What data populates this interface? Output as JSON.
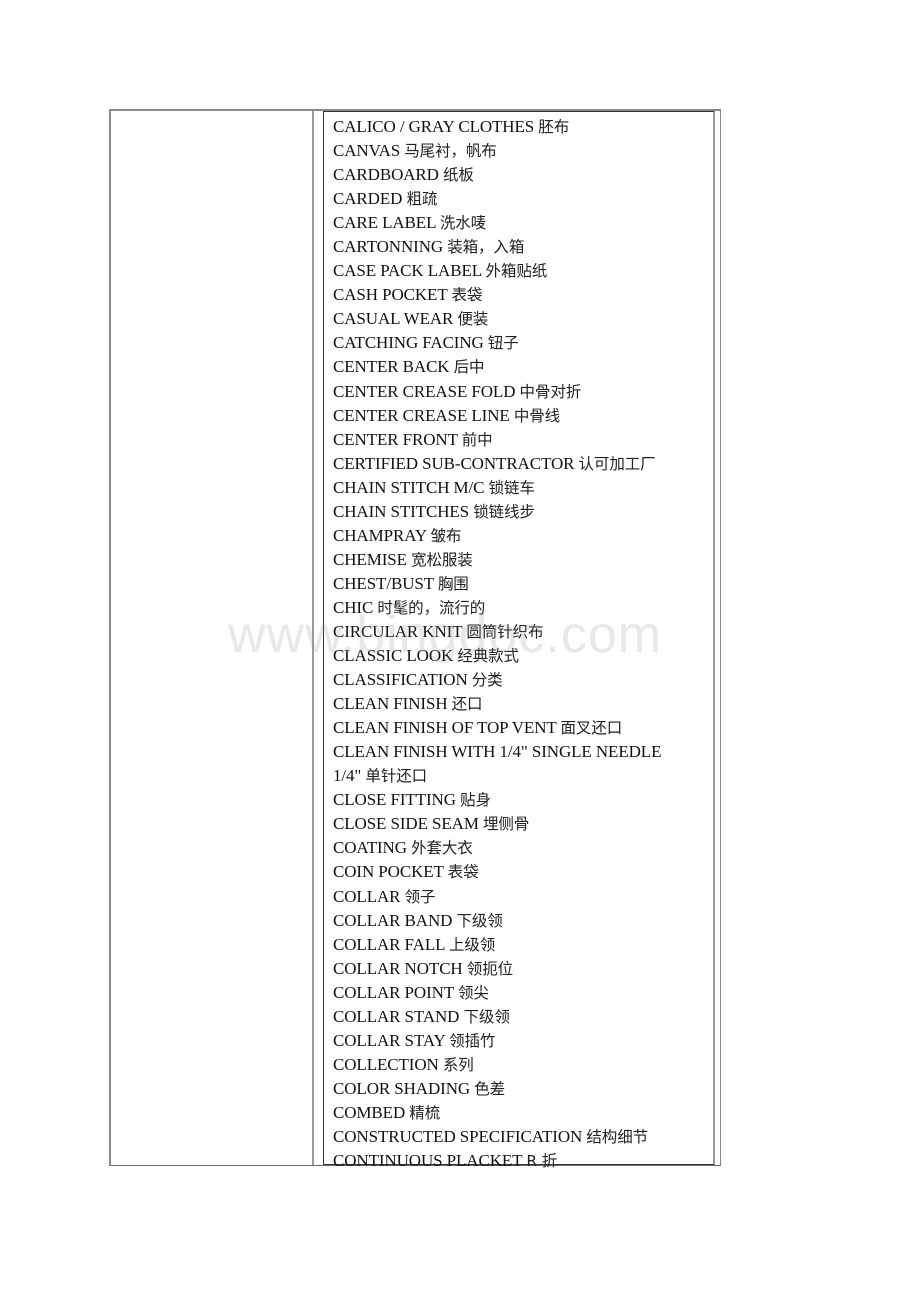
{
  "watermark": "www.bingdoc.com",
  "colors": {
    "text": "#111111",
    "border_outer": "#8a8a8a",
    "border_inner": "#333333"
  },
  "table": {
    "left_cell": "",
    "terms": [
      {
        "en": "CALICO / GRAY CLOTHES",
        "cn": "胚布"
      },
      {
        "en": "CANVAS",
        "cn": "马尾衬，帆布"
      },
      {
        "en": "CARDBOARD",
        "cn": "纸板"
      },
      {
        "en": "CARDED",
        "cn": "粗疏"
      },
      {
        "en": "CARE LABEL",
        "cn": "洗水唛"
      },
      {
        "en": "CARTONNING",
        "cn": "装箱，入箱"
      },
      {
        "en": "CASE PACK LABEL",
        "cn": "外箱贴纸"
      },
      {
        "en": "CASH POCKET",
        "cn": "表袋"
      },
      {
        "en": "CASUAL WEAR",
        "cn": "便装"
      },
      {
        "en": "CATCHING FACING",
        "cn": "钮子"
      },
      {
        "en": "CENTER BACK",
        "cn": "后中"
      },
      {
        "en": "CENTER CREASE FOLD",
        "cn": "中骨对折"
      },
      {
        "en": "CENTER CREASE LINE",
        "cn": "中骨线"
      },
      {
        "en": "CENTER FRONT",
        "cn": "前中"
      },
      {
        "en": "CERTIFIED SUB-CONTRACTOR",
        "cn": "认可加工厂"
      },
      {
        "en": "CHAIN STITCH M/C",
        "cn": "锁链车"
      },
      {
        "en": "CHAIN STITCHES",
        "cn": "锁链线步"
      },
      {
        "en": "CHAMPRAY",
        "cn": "皱布"
      },
      {
        "en": "CHEMISE",
        "cn": "宽松服装"
      },
      {
        "en": "CHEST/BUST",
        "cn": "胸围"
      },
      {
        "en": "CHIC",
        "cn": "时髦的，流行的"
      },
      {
        "en": "CIRCULAR KNIT",
        "cn": "圆筒针织布"
      },
      {
        "en": "CLASSIC LOOK",
        "cn": "经典款式"
      },
      {
        "en": "CLASSIFICATION",
        "cn": "分类"
      },
      {
        "en": "CLEAN FINISH",
        "cn": "还口"
      },
      {
        "en": "CLEAN FINISH OF TOP VENT",
        "cn": "面叉还口"
      },
      {
        "en": "CLEAN FINISH WITH 1/4\" SINGLE NEEDLE",
        "cn": ""
      },
      {
        "en": "1/4\"",
        "cn": "单针还口"
      },
      {
        "en": "CLOSE FITTING",
        "cn": "贴身"
      },
      {
        "en": "CLOSE SIDE SEAM",
        "cn": "埋侧骨"
      },
      {
        "en": "COATING",
        "cn": "外套大衣"
      },
      {
        "en": "COIN POCKET",
        "cn": "表袋"
      },
      {
        "en": "COLLAR",
        "cn": "领子"
      },
      {
        "en": "COLLAR BAND",
        "cn": "下级领"
      },
      {
        "en": "COLLAR FALL",
        "cn": "上级领"
      },
      {
        "en": "COLLAR NOTCH",
        "cn": "领扼位"
      },
      {
        "en": "COLLAR POINT",
        "cn": "领尖"
      },
      {
        "en": "COLLAR STAND",
        "cn": "下级领"
      },
      {
        "en": "COLLAR STAY",
        "cn": "领插竹"
      },
      {
        "en": "COLLECTION",
        "cn": "系列"
      },
      {
        "en": "COLOR SHADING",
        "cn": "色差"
      },
      {
        "en": "COMBED",
        "cn": "精梳"
      },
      {
        "en": "CONSTRUCTED SPECIFICATION",
        "cn": "结构细节"
      },
      {
        "en": "CONTINUOUS PLACKET",
        "cn": "R 折"
      }
    ]
  }
}
